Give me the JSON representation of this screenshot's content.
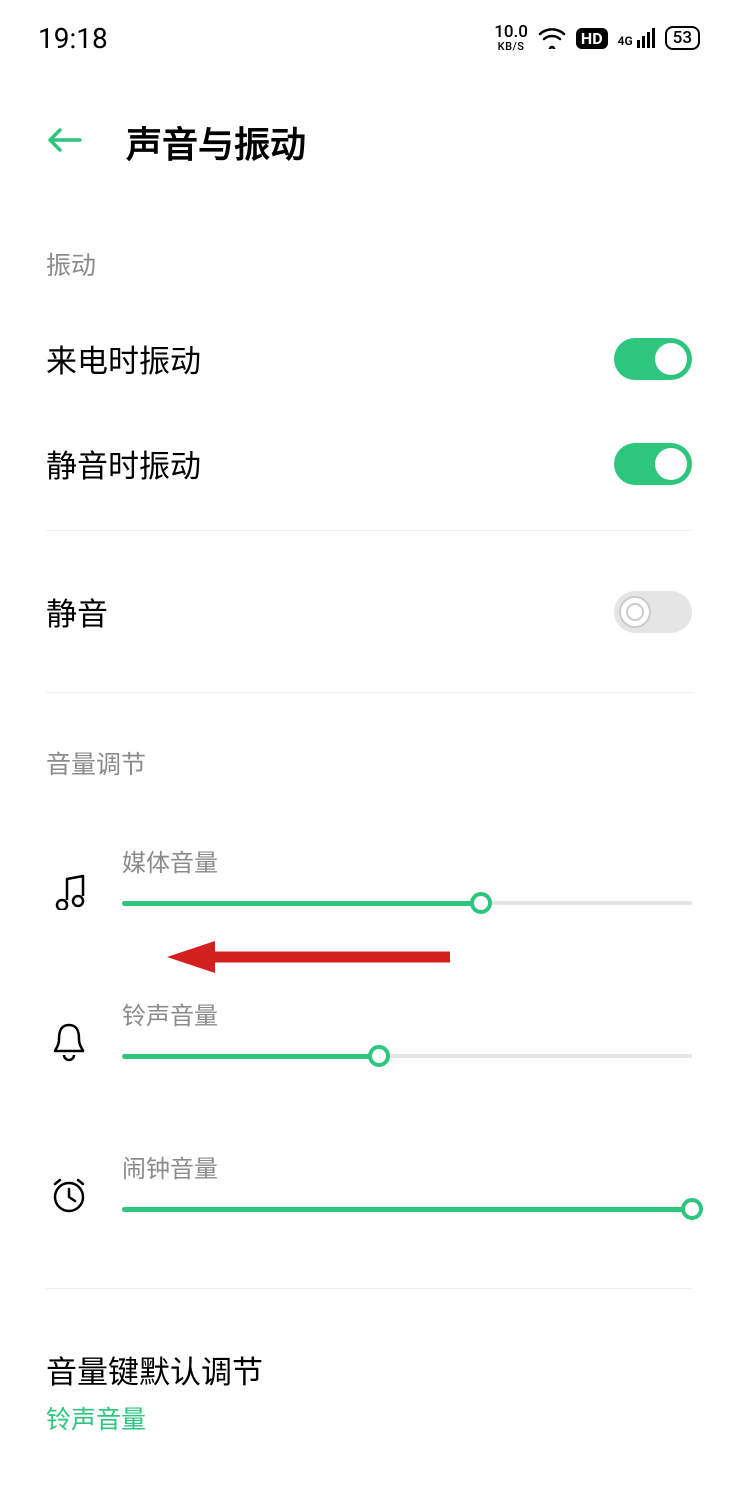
{
  "status": {
    "time": "19:18",
    "net_speed_top": "10.0",
    "net_speed_bot": "KB/S",
    "hd_label": "HD",
    "net_gen": "4G",
    "battery": "53"
  },
  "header": {
    "title": "声音与振动"
  },
  "vibration": {
    "section": "振动",
    "vibrate_on_ring": {
      "label": "来电时振动",
      "on": true
    },
    "vibrate_on_silent": {
      "label": "静音时振动",
      "on": true
    }
  },
  "mute": {
    "label": "静音",
    "on": false
  },
  "volume": {
    "section": "音量调节",
    "media": {
      "label": "媒体音量",
      "percent": 63
    },
    "ring": {
      "label": "铃声音量",
      "percent": 45
    },
    "alarm": {
      "label": "闹钟音量",
      "percent": 100
    }
  },
  "volume_key": {
    "label": "音量键默认调节",
    "value": "铃声音量"
  },
  "colors": {
    "accent": "#2ec67f"
  }
}
